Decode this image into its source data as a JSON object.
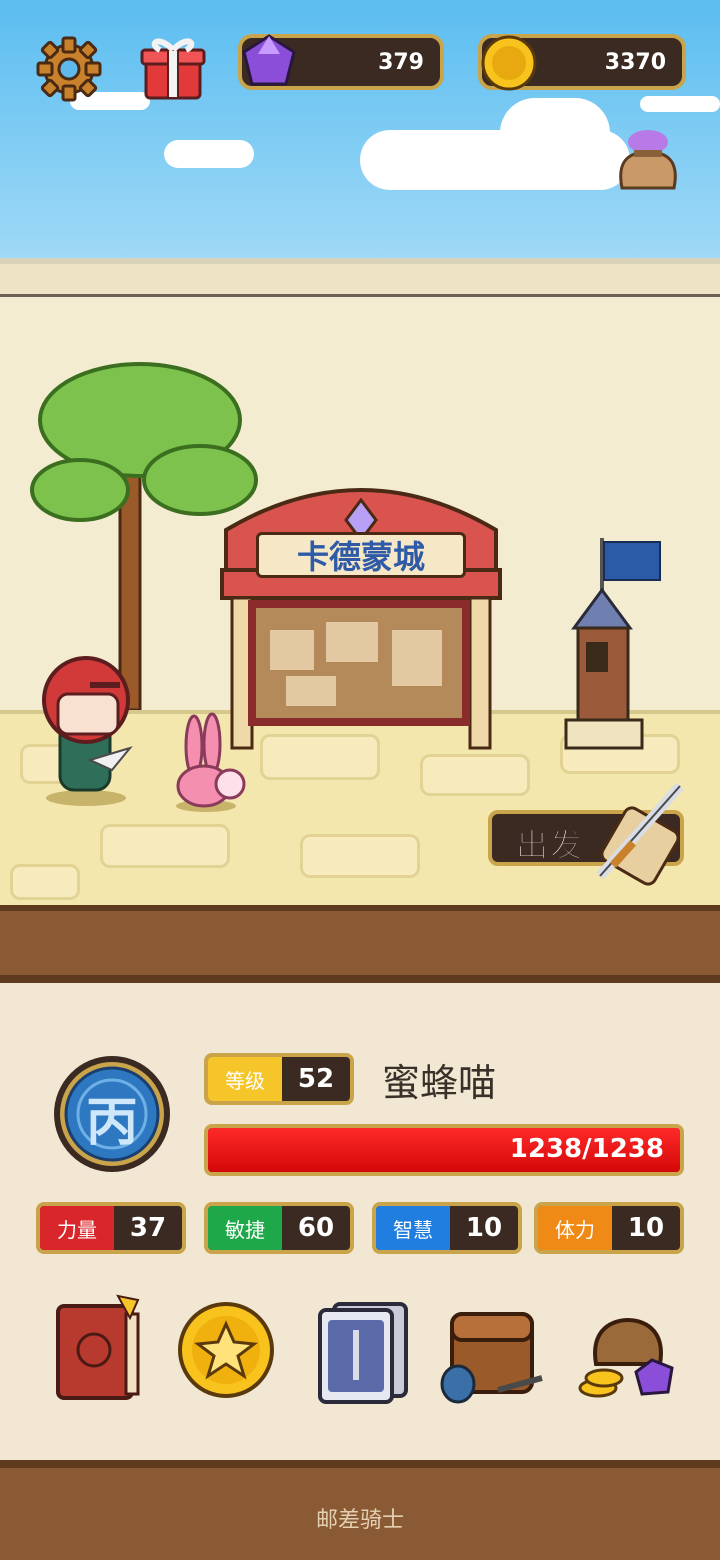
{
  "hud": {
    "gems": "379",
    "coins": "3370",
    "icons": [
      "gear-icon",
      "gift-icon",
      "gem-icon",
      "coin-icon",
      "treasure-bag-icon"
    ]
  },
  "town": {
    "sign": "卡德蒙城",
    "depart_label": "出发"
  },
  "character": {
    "rank_glyph": "丙",
    "level_label": "等级",
    "level": "52",
    "name": "蜜蜂喵",
    "hp_text": "1238/1238",
    "hp_fraction": 1.0,
    "stats": [
      {
        "label": "力量",
        "value": "37",
        "color": "#d9262b"
      },
      {
        "label": "敏捷",
        "value": "60",
        "color": "#1fa84a"
      },
      {
        "label": "智慧",
        "value": "10",
        "color": "#1f7ee0"
      },
      {
        "label": "体力",
        "value": "10",
        "color": "#f08a16"
      }
    ]
  },
  "toolbar_icons": [
    "hero-book-icon",
    "star-coin-icon",
    "skill-cards-icon",
    "inventory-chest-icon",
    "treasure-bag-icon"
  ],
  "footer": {
    "app_name": "邮差骑士"
  }
}
